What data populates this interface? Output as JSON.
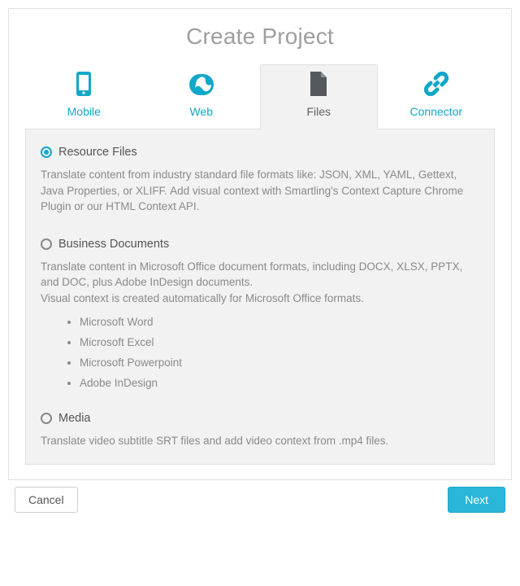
{
  "title": "Create Project",
  "tabs": [
    {
      "id": "mobile",
      "label": "Mobile",
      "active": false
    },
    {
      "id": "web",
      "label": "Web",
      "active": false
    },
    {
      "id": "files",
      "label": "Files",
      "active": true
    },
    {
      "id": "connector",
      "label": "Connector",
      "active": false
    }
  ],
  "options": {
    "resource": {
      "title": "Resource Files",
      "selected": true,
      "desc": "Translate content from industry standard file formats like: JSON, XML, YAML, Gettext, Java Properties, or XLIFF. Add visual context with Smartling's Context Capture Chrome Plugin or our HTML Context API."
    },
    "business": {
      "title": "Business Documents",
      "selected": false,
      "desc": "Translate content in Microsoft Office document formats, including DOCX, XLSX, PPTX, and DOC, plus Adobe InDesign documents.\nVisual context is created automatically for Microsoft Office formats.",
      "items": [
        "Microsoft Word",
        "Microsoft Excel",
        "Microsoft Powerpoint",
        "Adobe InDesign"
      ]
    },
    "media": {
      "title": "Media",
      "selected": false,
      "desc": "Translate video subtitle SRT files and add video context from .mp4 files."
    }
  },
  "buttons": {
    "cancel": "Cancel",
    "next": "Next"
  },
  "colors": {
    "accent": "#11a7c9",
    "primary_btn": "#29b6d8"
  }
}
